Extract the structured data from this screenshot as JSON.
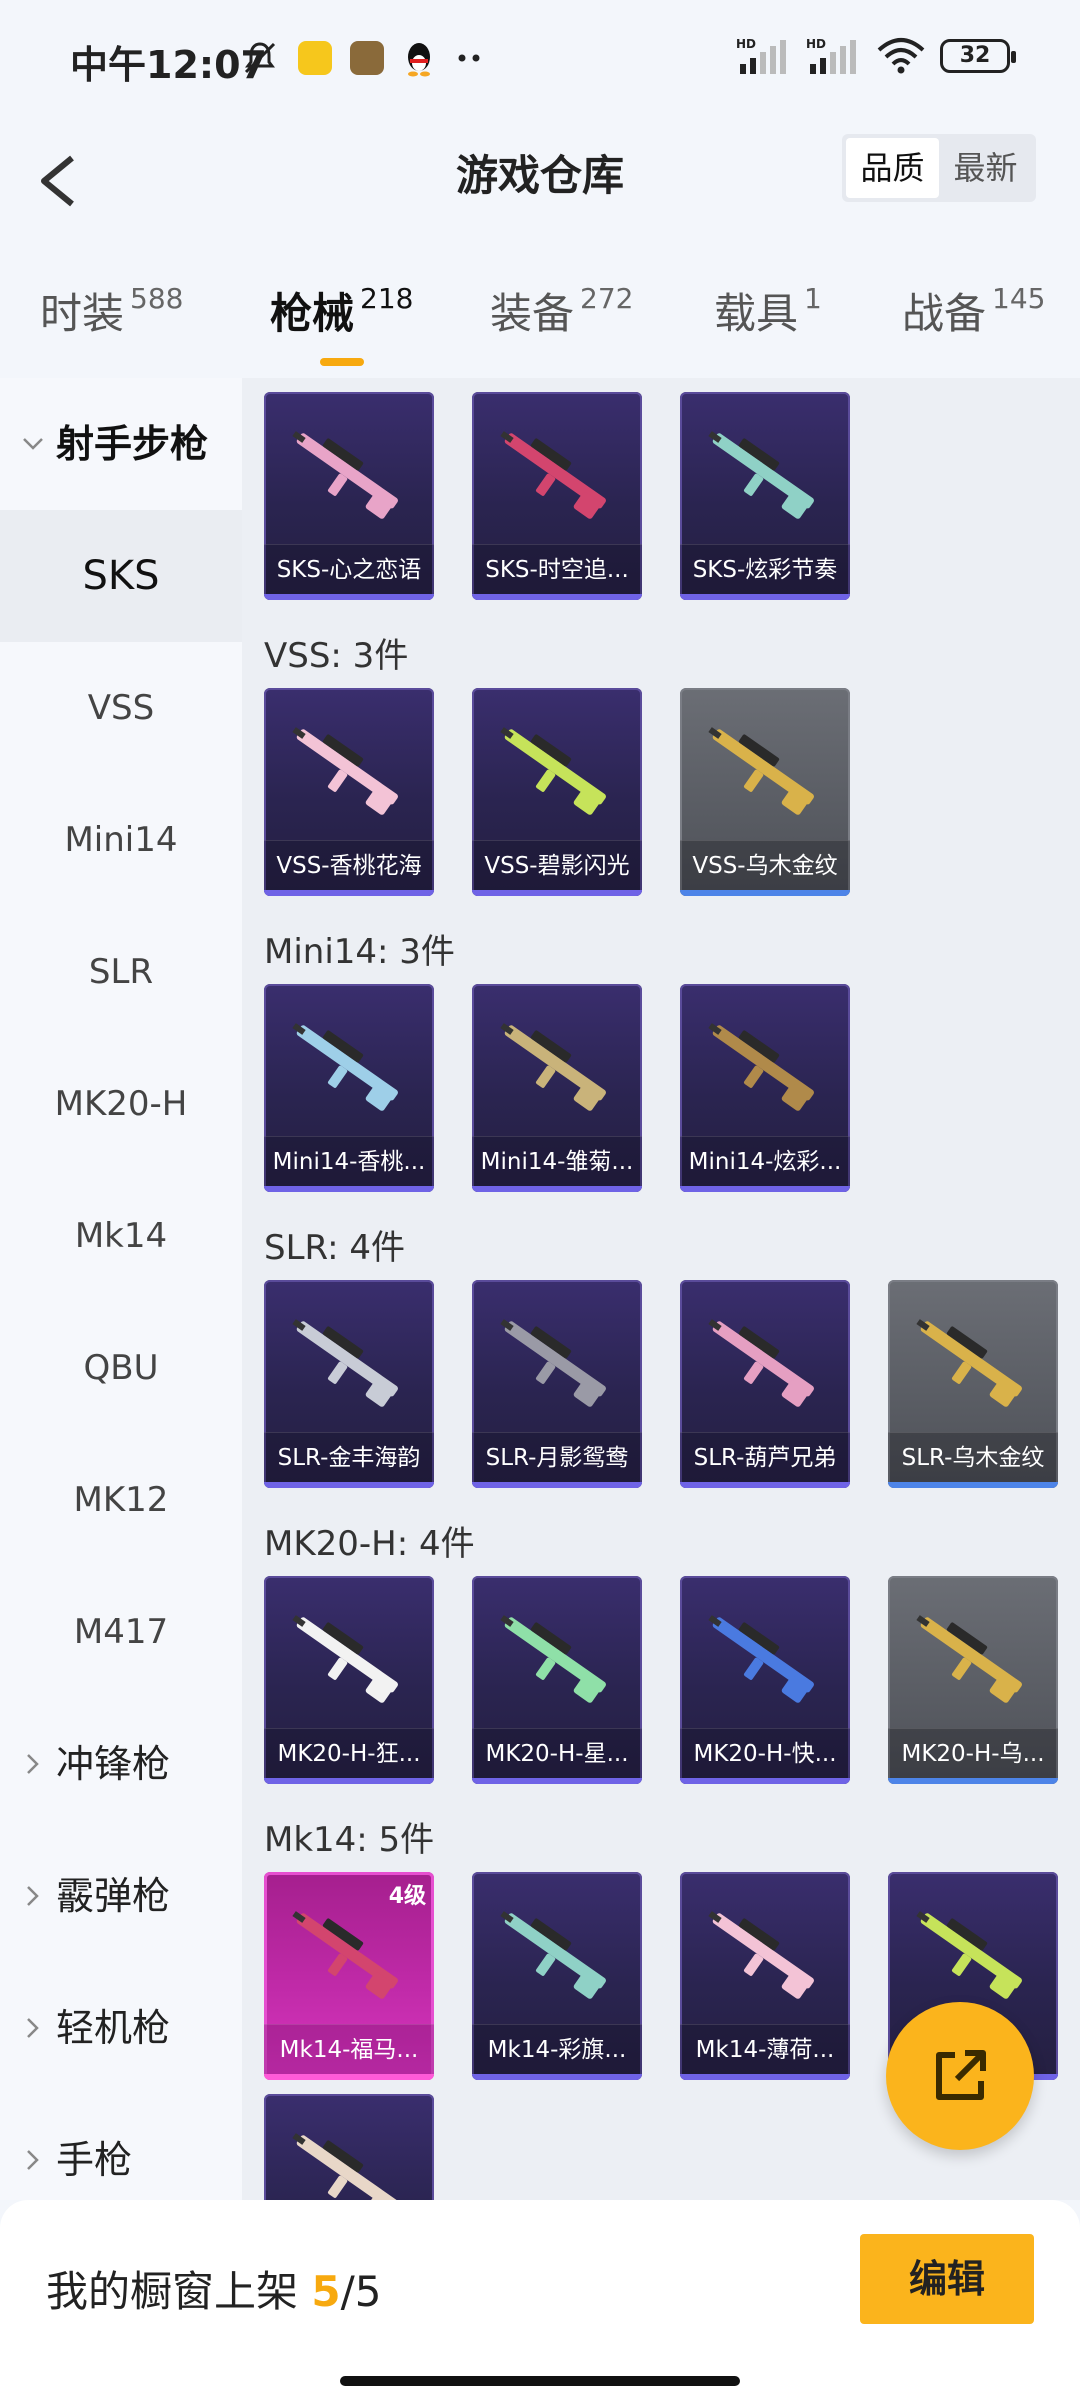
{
  "status_bar": {
    "time": "中午12:07",
    "battery": "32",
    "icons": [
      "mute-bell-icon",
      "app-icon-yellow",
      "app-icon-game",
      "qq-penguin-icon",
      "more-dots-icon",
      "hd-signal-icon",
      "hd-signal-icon",
      "wifi-icon",
      "battery-icon"
    ]
  },
  "header": {
    "title": "游戏仓库",
    "back_icon": "back-arrow-icon",
    "sort_options": [
      "品质",
      "最新"
    ],
    "sort_selected": "品质"
  },
  "tabs": [
    {
      "label": "时装",
      "count": "588"
    },
    {
      "label": "枪械",
      "count": "218",
      "active": true
    },
    {
      "label": "装备",
      "count": "272"
    },
    {
      "label": "载具",
      "count": "1"
    },
    {
      "label": "战备",
      "count": "145"
    }
  ],
  "sidebar": {
    "group_expanded": "射手步枪",
    "items": [
      "SKS",
      "VSS",
      "Mini14",
      "SLR",
      "MK20-H",
      "Mk14",
      "QBU",
      "MK12",
      "M417"
    ],
    "selected": "SKS",
    "collapsed_groups": [
      "冲锋枪",
      "霰弹枪",
      "轻机枪",
      "手枪"
    ]
  },
  "sections": [
    {
      "title": "",
      "items": [
        {
          "name": "SKS-心之恋语",
          "style": "purple"
        },
        {
          "name": "SKS-时空追...",
          "style": "purple"
        },
        {
          "name": "SKS-炫彩节奏",
          "style": "purple"
        }
      ]
    },
    {
      "title": "VSS: 3件",
      "items": [
        {
          "name": "VSS-香桃花海",
          "style": "purple"
        },
        {
          "name": "VSS-碧影闪光",
          "style": "purple"
        },
        {
          "name": "VSS-乌木金纹",
          "style": "grey"
        }
      ]
    },
    {
      "title": "Mini14: 3件",
      "items": [
        {
          "name": "Mini14-香桃...",
          "style": "purple"
        },
        {
          "name": "Mini14-雏菊...",
          "style": "purple"
        },
        {
          "name": "Mini14-炫彩...",
          "style": "purple"
        }
      ]
    },
    {
      "title": "SLR: 4件",
      "items": [
        {
          "name": "SLR-金丰海韵",
          "style": "purple"
        },
        {
          "name": "SLR-月影鸳鸯",
          "style": "purple"
        },
        {
          "name": "SLR-葫芦兄弟",
          "style": "purple"
        },
        {
          "name": "SLR-乌木金纹",
          "style": "grey"
        }
      ]
    },
    {
      "title": "MK20-H: 4件",
      "items": [
        {
          "name": "MK20-H-狂...",
          "style": "purple"
        },
        {
          "name": "MK20-H-星...",
          "style": "purple"
        },
        {
          "name": "MK20-H-快...",
          "style": "purple"
        },
        {
          "name": "MK20-H-乌...",
          "style": "grey"
        }
      ]
    },
    {
      "title": "Mk14: 5件",
      "items": [
        {
          "name": "Mk14-福马...",
          "style": "pink",
          "level": "4级"
        },
        {
          "name": "Mk14-彩旗...",
          "style": "purple"
        },
        {
          "name": "Mk14-薄荷...",
          "style": "purple"
        },
        {
          "name": "",
          "style": "purple"
        },
        {
          "name": "",
          "style": "purple"
        }
      ]
    }
  ],
  "fab": {
    "icon": "share-export-icon"
  },
  "bottom_bar": {
    "label": "我的橱窗上架",
    "current": "5",
    "total": "/5",
    "edit_label": "编辑"
  },
  "colors": {
    "accent": "#fbb41c",
    "tab_underline": "#f7a90f",
    "card_purple": "#2a2450",
    "card_grey": "#4d5057",
    "card_pink": "#c02aa8"
  }
}
